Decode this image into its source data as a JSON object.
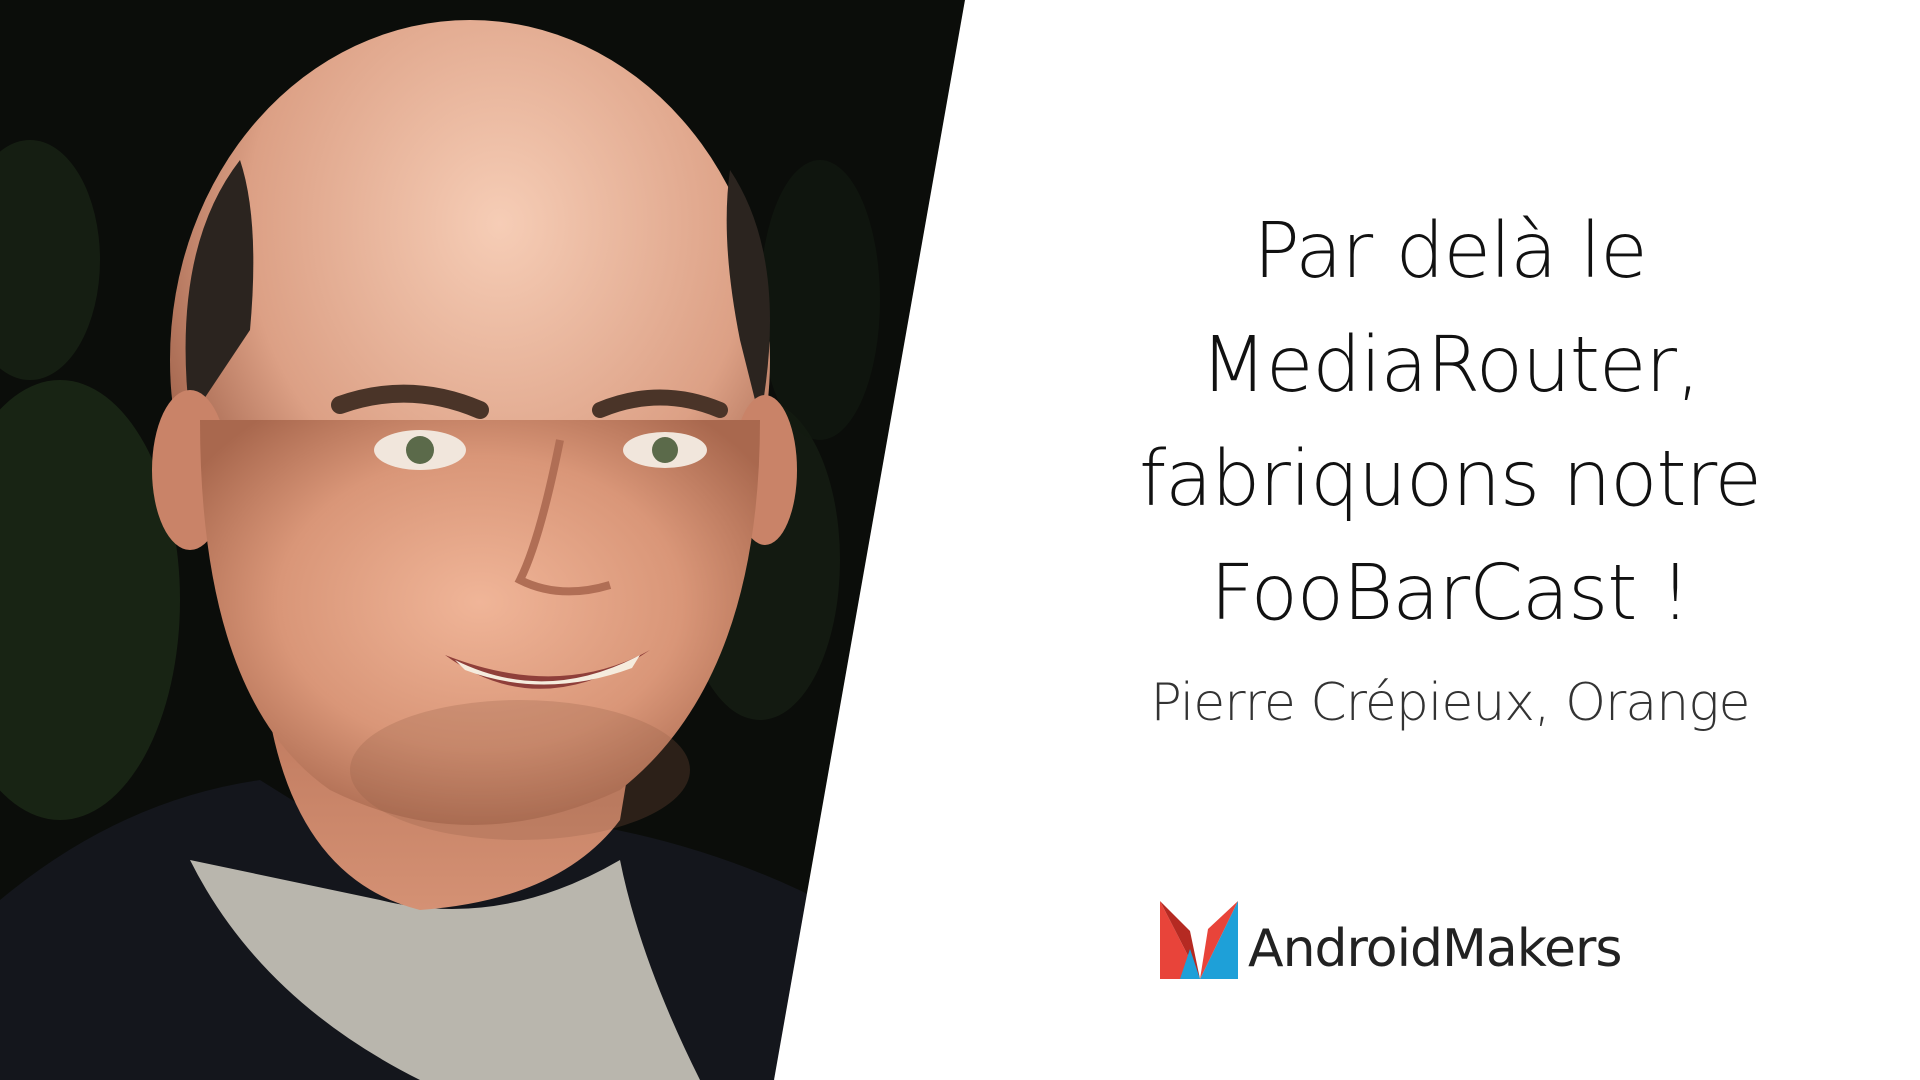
{
  "slide": {
    "title_lines": [
      "Par delà le",
      "MediaRouter,",
      "fabriquons notre",
      "FooBarCast !"
    ],
    "speaker": "Pierre Crépieux, Orange"
  },
  "brand": {
    "name": "AndroidMakers",
    "logo_colors": {
      "red": "#e8443a",
      "blue": "#1ea0d8",
      "dark_red": "#b52a22"
    }
  },
  "photo": {
    "icon": "speaker-photo",
    "background_color": "#0b0d0a",
    "skin_color": "#e0a486",
    "shirt_color": "#14161c"
  }
}
